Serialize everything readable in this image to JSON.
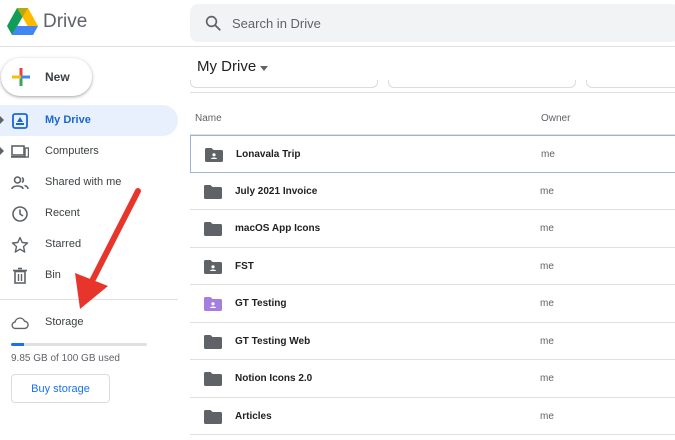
{
  "header": {
    "app_name": "Drive",
    "search_placeholder": "Search in Drive"
  },
  "sidebar": {
    "new_label": "New",
    "items": [
      {
        "label": "My Drive",
        "icon": "my-drive-icon",
        "active": true,
        "caret": true
      },
      {
        "label": "Computers",
        "icon": "computers-icon",
        "active": false,
        "caret": true
      },
      {
        "label": "Shared with me",
        "icon": "shared-icon",
        "active": false,
        "caret": false
      },
      {
        "label": "Recent",
        "icon": "clock-icon",
        "active": false,
        "caret": false
      },
      {
        "label": "Starred",
        "icon": "star-icon",
        "active": false,
        "caret": false
      },
      {
        "label": "Bin",
        "icon": "trash-icon",
        "active": false,
        "caret": false
      }
    ],
    "storage": {
      "label": "Storage",
      "used_text": "9.85 GB of 100 GB used",
      "used_fraction": 0.0985,
      "buy_label": "Buy storage"
    }
  },
  "main": {
    "title": "My Drive",
    "columns": {
      "name": "Name",
      "owner": "Owner"
    },
    "files": [
      {
        "name": "Lonavala Trip",
        "owner": "me",
        "type": "shared-folder",
        "color": "#5f6368"
      },
      {
        "name": "July 2021 Invoice",
        "owner": "me",
        "type": "folder",
        "color": "#5f6368"
      },
      {
        "name": "macOS App Icons",
        "owner": "me",
        "type": "folder",
        "color": "#5f6368"
      },
      {
        "name": "FST",
        "owner": "me",
        "type": "shared-folder",
        "color": "#5f6368"
      },
      {
        "name": "GT Testing",
        "owner": "me",
        "type": "shared-folder",
        "color": "#a57fde"
      },
      {
        "name": "GT Testing Web",
        "owner": "me",
        "type": "folder",
        "color": "#5f6368"
      },
      {
        "name": "Notion Icons 2.0",
        "owner": "me",
        "type": "folder",
        "color": "#5f6368"
      },
      {
        "name": "Articles",
        "owner": "me",
        "type": "folder",
        "color": "#5f6368"
      }
    ]
  },
  "colors": {
    "accent": "#1a73e8",
    "active_bg": "#e8f0fe",
    "annotation_arrow": "#e8352b"
  }
}
